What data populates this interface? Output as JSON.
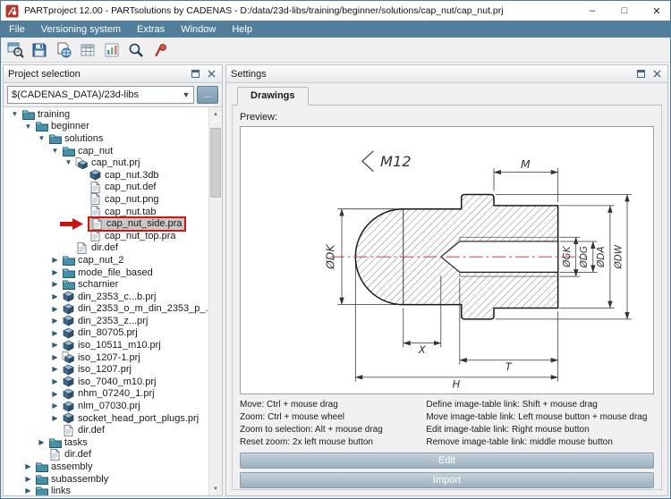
{
  "window": {
    "title": "PARTproject 12.00 - PARTsolutions by CADENAS - D:/data/23d-libs/training/beginner/solutions/cap_nut/cap_nut.prj",
    "controls": {
      "minimize": "–",
      "maximize": "□",
      "close": "✕"
    }
  },
  "menu": {
    "items": [
      "File",
      "Versioning system",
      "Extras",
      "Window",
      "Help"
    ]
  },
  "toolbar": {
    "icons": [
      "window-search",
      "save",
      "world-doc",
      "table",
      "chart",
      "search",
      "publish"
    ]
  },
  "project_panel": {
    "title": "Project selection",
    "path_value": "$(CADENAS_DATA)/23d-libs",
    "browse_label": "...",
    "tree": [
      {
        "label": "training",
        "level": 0,
        "icon": "folder",
        "expander": "expanded"
      },
      {
        "label": "beginner",
        "level": 1,
        "icon": "folder",
        "expander": "expanded"
      },
      {
        "label": "solutions",
        "level": 2,
        "icon": "folder",
        "expander": "expanded"
      },
      {
        "label": "cap_nut",
        "level": 3,
        "icon": "folder",
        "expander": "expanded"
      },
      {
        "label": "cap_nut.prj",
        "level": 4,
        "icon": "project",
        "expander": "expanded"
      },
      {
        "label": "cap_nut.3db",
        "level": 5,
        "icon": "cube",
        "expander": "none"
      },
      {
        "label": "cap_nut.def",
        "level": 5,
        "icon": "doc",
        "expander": "none"
      },
      {
        "label": "cap_nut.png",
        "level": 5,
        "icon": "doc",
        "expander": "none"
      },
      {
        "label": "cap_nut.tab",
        "level": 5,
        "icon": "doc",
        "expander": "none"
      },
      {
        "label": "cap_nut_side.pra",
        "level": 5,
        "icon": "doc",
        "expander": "none",
        "highlighted": true
      },
      {
        "label": "cap_nut_top.pra",
        "level": 5,
        "icon": "doc",
        "expander": "none"
      },
      {
        "label": "dir.def",
        "level": 4,
        "icon": "doc",
        "expander": "none"
      },
      {
        "label": "cap_nut_2",
        "level": 3,
        "icon": "folder",
        "expander": "collapsed"
      },
      {
        "label": "mode_file_based",
        "level": 3,
        "icon": "folder",
        "expander": "collapsed"
      },
      {
        "label": "scharnier",
        "level": 3,
        "icon": "folder",
        "expander": "collapsed"
      },
      {
        "label": "din_2353_c...b.prj",
        "level": 3,
        "icon": "cube",
        "expander": "collapsed"
      },
      {
        "label": "din_2353_o_m_din_2353_p_...",
        "level": 3,
        "icon": "cube",
        "expander": "collapsed"
      },
      {
        "label": "din_2353_z...prj",
        "level": 3,
        "icon": "cube",
        "expander": "collapsed"
      },
      {
        "label": "din_80705.prj",
        "level": 3,
        "icon": "cube",
        "expander": "collapsed"
      },
      {
        "label": "iso_10511_m10.prj",
        "level": 3,
        "icon": "cube",
        "expander": "collapsed"
      },
      {
        "label": "iso_1207-1.prj",
        "level": 3,
        "icon": "project",
        "expander": "collapsed"
      },
      {
        "label": "iso_1207.prj",
        "level": 3,
        "icon": "cube",
        "expander": "collapsed"
      },
      {
        "label": "iso_7040_m10.prj",
        "level": 3,
        "icon": "cube",
        "expander": "collapsed"
      },
      {
        "label": "nhm_07240_1.prj",
        "level": 3,
        "icon": "cube",
        "expander": "collapsed"
      },
      {
        "label": "nlm_07030.prj",
        "level": 3,
        "icon": "cube",
        "expander": "collapsed"
      },
      {
        "label": "socket_head_port_plugs.prj",
        "level": 3,
        "icon": "cube",
        "expander": "collapsed"
      },
      {
        "label": "dir.def",
        "level": 3,
        "icon": "doc",
        "expander": "none"
      },
      {
        "label": "tasks",
        "level": 2,
        "icon": "folder",
        "expander": "collapsed"
      },
      {
        "label": "dir.def",
        "level": 2,
        "icon": "doc",
        "expander": "none"
      },
      {
        "label": "assembly",
        "level": 1,
        "icon": "folder",
        "expander": "collapsed"
      },
      {
        "label": "subassembly",
        "level": 1,
        "icon": "folder",
        "expander": "collapsed"
      },
      {
        "label": "links",
        "level": 1,
        "icon": "folder",
        "expander": "collapsed"
      }
    ]
  },
  "settings_panel": {
    "title": "Settings",
    "tab_label": "Drawings",
    "preview_label": "Preview:",
    "help_left": [
      "Move: Ctrl + mouse drag",
      "Zoom: Ctrl + mouse wheel",
      "Zoom to selection: Alt + mouse drag",
      "Reset zoom: 2x left mouse button"
    ],
    "help_right": [
      "Define image-table link: Shift + mouse drag",
      "Move image-table link: Left mouse button + mouse drag",
      "Edit image-table link: Right mouse button",
      "Remove image-table link: middle mouse button"
    ],
    "edit_button": "Edit",
    "import_button": "Import"
  },
  "drawing": {
    "labels": {
      "thread": "M12",
      "m": "M",
      "dk": "ØDK",
      "gk": "ØGK",
      "dg": "ØDG",
      "da": "ØDA",
      "dw": "ØDW",
      "x": "X",
      "t": "T",
      "h": "H"
    }
  }
}
